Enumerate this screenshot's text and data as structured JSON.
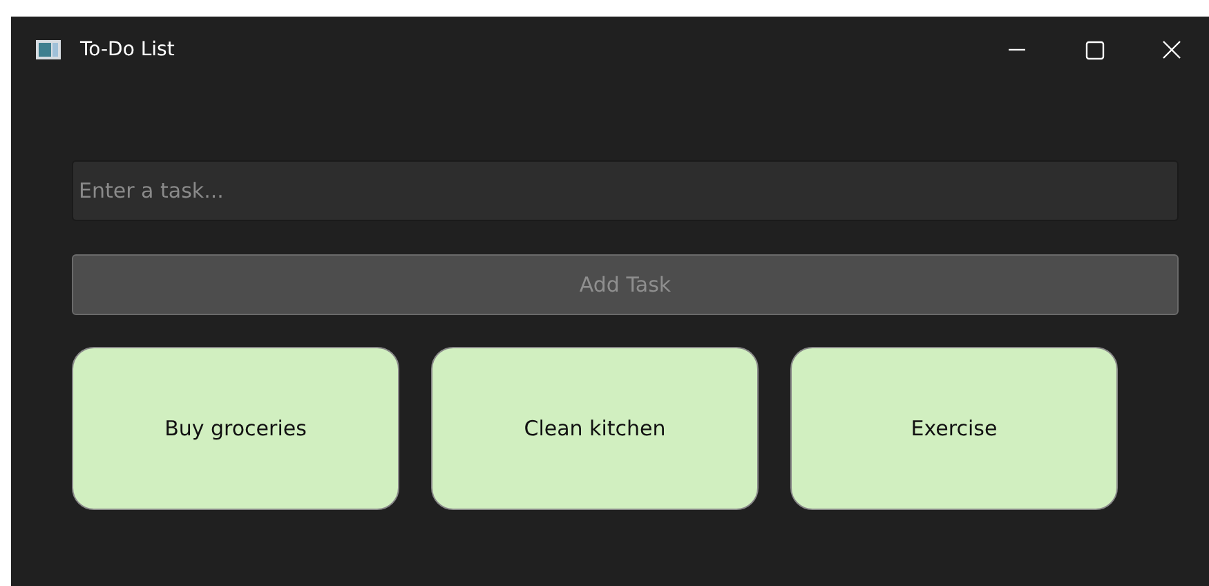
{
  "window": {
    "title": "To-Do List"
  },
  "task_input": {
    "placeholder": "Enter a task..."
  },
  "add_button": {
    "label": "Add Task",
    "disabled": true
  },
  "tasks": [
    {
      "label": "Buy groceries"
    },
    {
      "label": "Clean kitchen"
    },
    {
      "label": "Exercise"
    }
  ]
}
